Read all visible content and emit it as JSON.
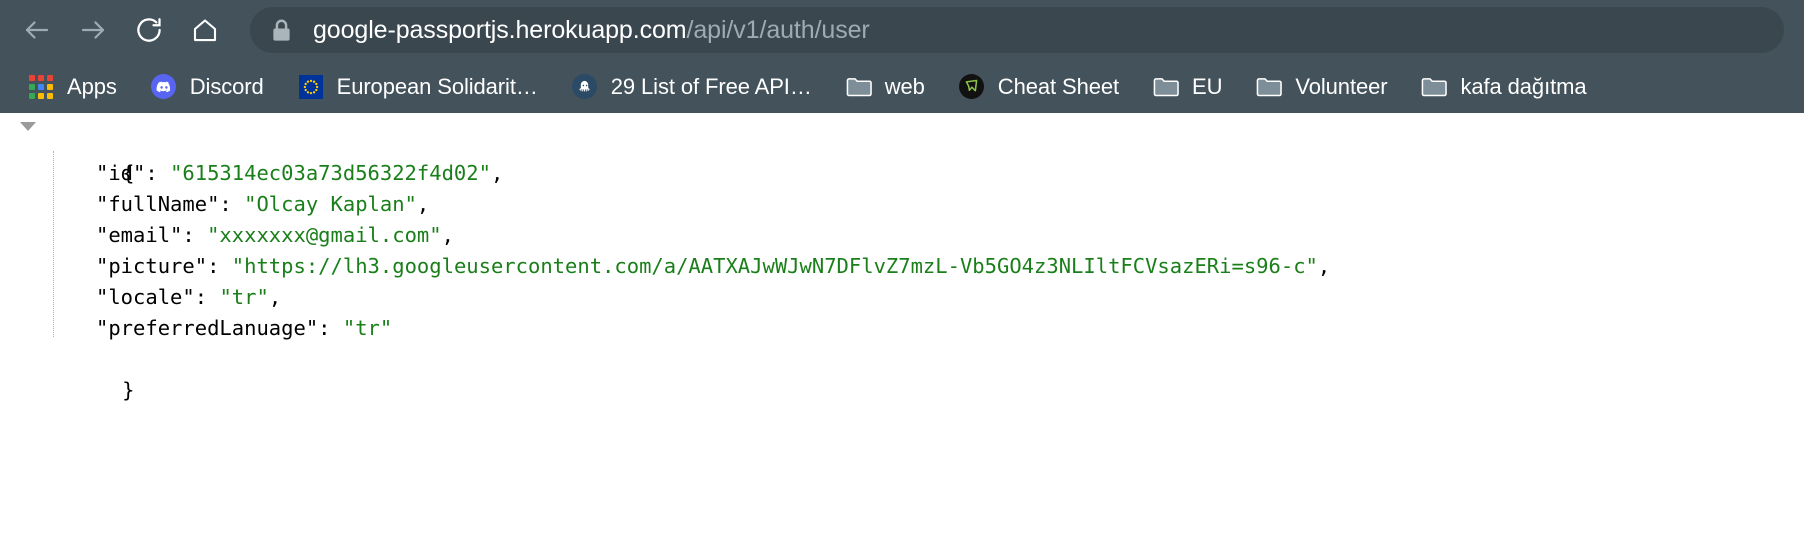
{
  "browser": {
    "nav": {
      "back_label": "Back",
      "forward_label": "Forward",
      "reload_label": "Reload",
      "home_label": "Home"
    },
    "omnibox": {
      "lock_icon": "lock-icon",
      "url_full": "google-passportjs.herokuapp.com/api/v1/auth/user",
      "url_host": "google-passportjs.herokuapp.com",
      "url_path": "/api/v1/auth/user"
    },
    "colors": {
      "chrome_bg": "#43525b",
      "omnibox_bg": "#3a474f",
      "url_host": "#ffffff",
      "url_path": "#9fabb3",
      "json_string": "#1a7f1a",
      "json_key": "#000000"
    },
    "bookmarks": [
      {
        "label": "Apps",
        "icon": "apps-grid-icon"
      },
      {
        "label": "Discord",
        "icon": "discord-icon"
      },
      {
        "label": "European Solidarit…",
        "icon": "european-union-icon"
      },
      {
        "label": "29 List of Free API…",
        "icon": "octopus-icon"
      },
      {
        "label": "web",
        "icon": "folder-icon"
      },
      {
        "label": "Cheat Sheet",
        "icon": "cheat-sheet-icon"
      },
      {
        "label": "EU",
        "icon": "folder-icon"
      },
      {
        "label": "Volunteer",
        "icon": "folder-icon"
      },
      {
        "label": "kafa dağıtma",
        "icon": "folder-icon"
      }
    ]
  },
  "json_viewer": {
    "collapse_toggle": "expanded",
    "open_brace": "{",
    "close_brace": "}",
    "lines": [
      {
        "key": "\"id\"",
        "sep": ": ",
        "value": "\"615314ec03a73d56322f4d02\"",
        "comma": ","
      },
      {
        "key": "\"fullName\"",
        "sep": ": ",
        "value": "\"Olcay Kaplan\"",
        "comma": ","
      },
      {
        "key": "\"email\"",
        "sep": ": ",
        "value": "\"xxxxxxx@gmail.com\"",
        "comma": ","
      },
      {
        "key": "\"picture\"",
        "sep": ": ",
        "value": "\"https://lh3.googleusercontent.com/a/AATXAJwWJwN7DFlvZ7mzL-Vb5GO4z3NLIltFCVsazERi=s96-c\"",
        "comma": ","
      },
      {
        "key": "\"locale\"",
        "sep": ": ",
        "value": "\"tr\"",
        "comma": ","
      },
      {
        "key": "\"preferredLanuage\"",
        "sep": ": ",
        "value": "\"tr\"",
        "comma": ""
      }
    ]
  }
}
